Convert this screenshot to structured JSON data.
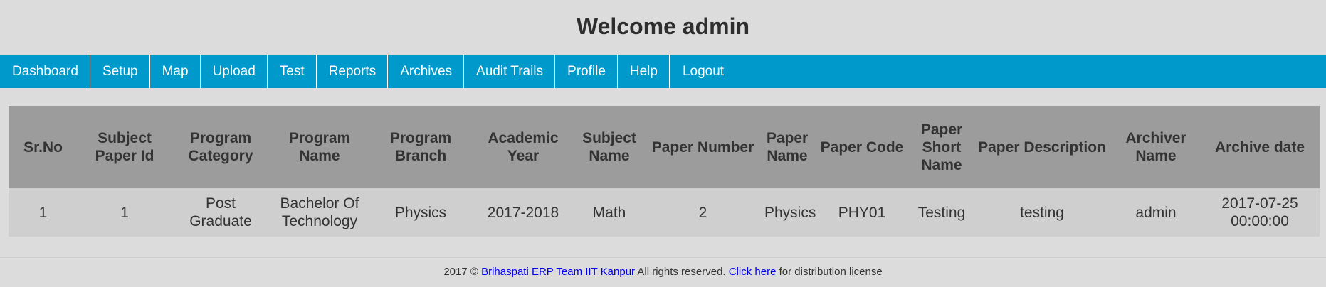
{
  "header": {
    "title": "Welcome admin"
  },
  "nav": {
    "items": [
      {
        "label": "Dashboard"
      },
      {
        "label": "Setup"
      },
      {
        "label": "Map"
      },
      {
        "label": "Upload"
      },
      {
        "label": "Test"
      },
      {
        "label": "Reports"
      },
      {
        "label": "Archives"
      },
      {
        "label": "Audit Trails"
      },
      {
        "label": "Profile"
      },
      {
        "label": "Help"
      },
      {
        "label": "Logout"
      }
    ]
  },
  "table": {
    "columns": [
      "Sr.No",
      "Subject Paper Id",
      "Program Category",
      "Program Name",
      "Program Branch",
      "Academic Year",
      "Subject Name",
      "Paper Number",
      "Paper Name",
      "Paper Code",
      "Paper Short Name",
      "Paper Description",
      "Archiver Name",
      "Archive date"
    ],
    "rows": [
      [
        "1",
        "1",
        "Post Graduate",
        "Bachelor Of Technology",
        "Physics",
        "2017-2018",
        "Math",
        "2",
        "Physics",
        "PHY01",
        "Testing",
        "testing",
        "admin",
        "2017-07-25 00:00:00"
      ]
    ]
  },
  "footer": {
    "prefix": "2017 © ",
    "team_link": "Brihaspati ERP Team IIT Kanpur",
    "middle": " All rights reserved. ",
    "license_link": "Click here ",
    "suffix": "for distribution license"
  },
  "colors": {
    "nav_bg": "#0099cc",
    "header_row_bg": "#9c9c9c",
    "data_row_bg": "#cfcfcf",
    "page_bg": "#dcdcdc",
    "link": "#0000ee"
  }
}
